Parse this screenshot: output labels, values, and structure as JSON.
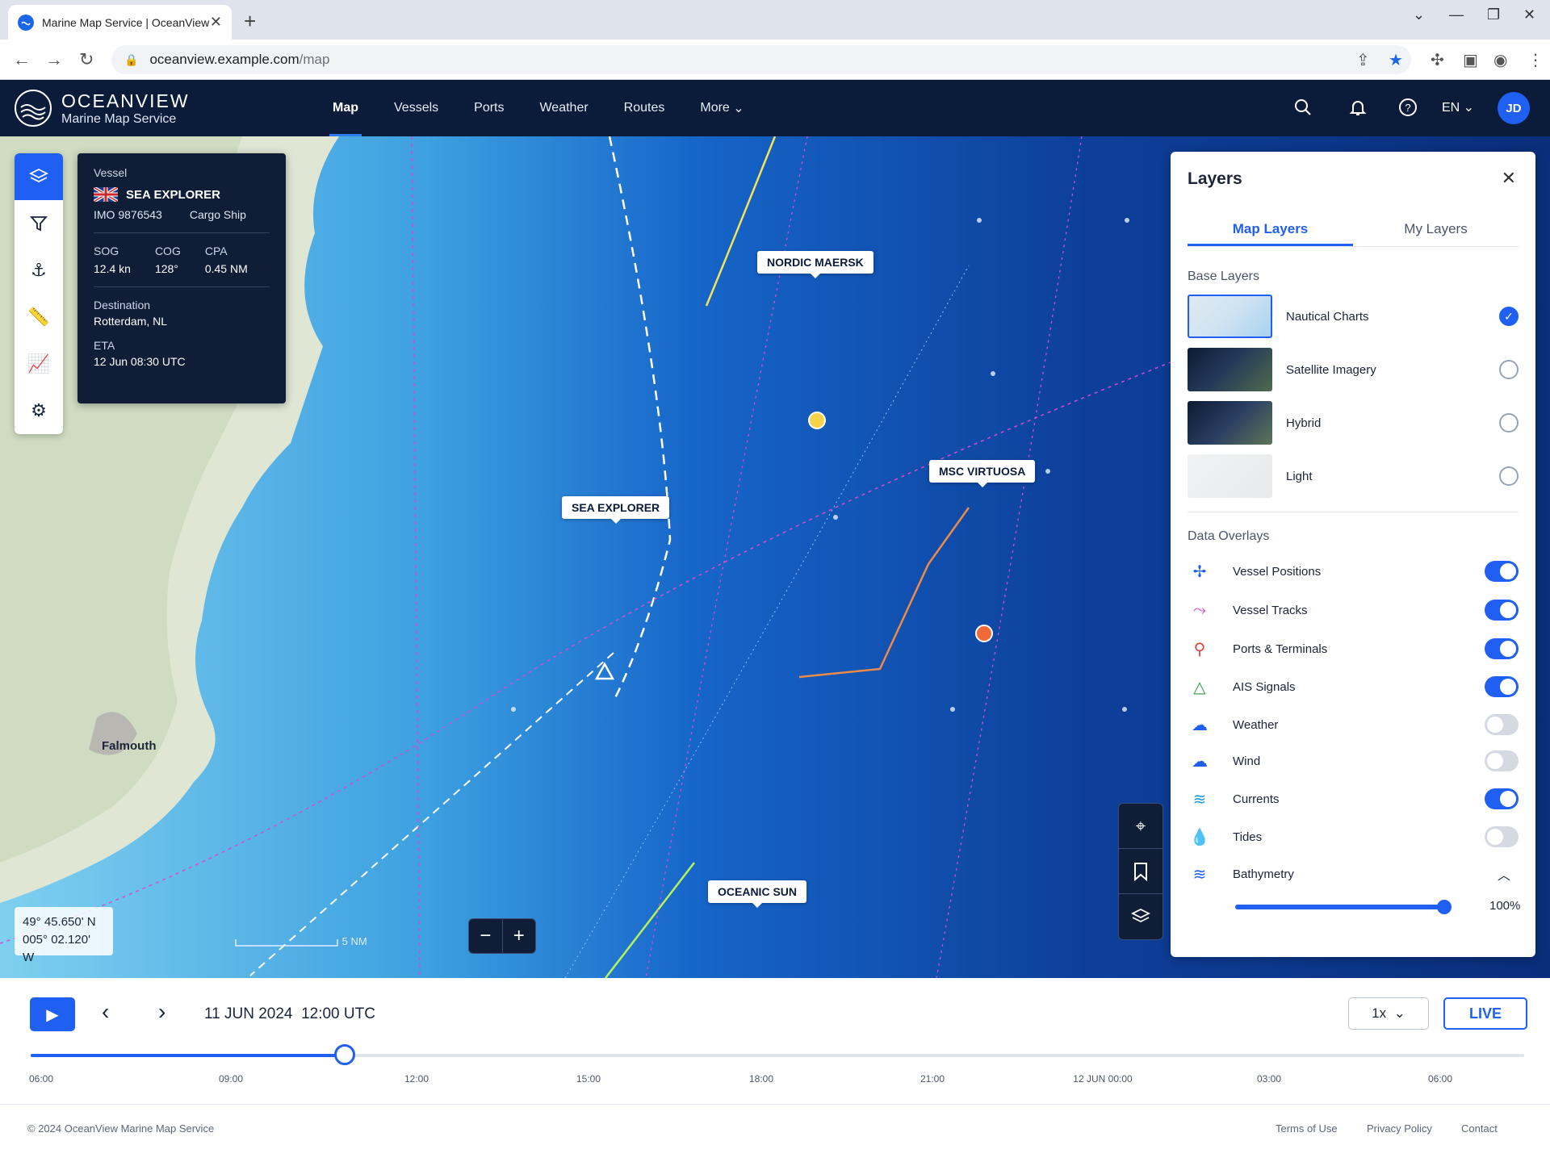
{
  "browser": {
    "tab_title": "Marine Map Service | OceanView",
    "url_host": "oceanview.example.com",
    "url_path": "/map"
  },
  "header": {
    "brand": "OCEANVIEW",
    "brand_sub": "Marine Map Service",
    "nav": [
      "Map",
      "Vessels",
      "Ports",
      "Weather",
      "Routes",
      "More"
    ],
    "active_nav": "Map",
    "language": "EN",
    "avatar_initials": "JD"
  },
  "vessel_card": {
    "label": "Vessel",
    "name": "SEA EXPLORER",
    "imo": "IMO 9876543",
    "type": "Cargo Ship",
    "stats": [
      {
        "k": "SOG",
        "v": "12.4 kn"
      },
      {
        "k": "COG",
        "v": "128°"
      },
      {
        "k": "CPA",
        "v": "0.45 NM"
      }
    ],
    "destination_label": "Destination",
    "destination": "Rotterdam, NL",
    "eta_label": "ETA",
    "eta": "12 Jun 08:30 UTC"
  },
  "map": {
    "vessel_labels": [
      "NORDIC MAERSK",
      "MSC VIRTUOSA",
      "SEA EXPLORER",
      "OCEANIC SUN"
    ],
    "place": "Falmouth",
    "coords_lat": "49° 45.650' N",
    "coords_lon": "005° 02.120' W",
    "scale": "5 NM"
  },
  "layers": {
    "title": "Layers",
    "tabs": [
      "Map Layers",
      "My Layers"
    ],
    "base_title": "Base Layers",
    "base": [
      {
        "name": "Nautical Charts",
        "selected": true
      },
      {
        "name": "Satellite Imagery",
        "selected": false
      },
      {
        "name": "Hybrid",
        "selected": false
      },
      {
        "name": "Light",
        "selected": false
      }
    ],
    "overlay_title": "Data Overlays",
    "overlays": [
      {
        "name": "Vessel Positions",
        "on": true,
        "icon": "vessel-positions-icon",
        "color": "#1f5ff2"
      },
      {
        "name": "Vessel Tracks",
        "on": true,
        "icon": "vessel-tracks-icon",
        "color": "#d64bd1"
      },
      {
        "name": "Ports & Terminals",
        "on": true,
        "icon": "port-icon",
        "color": "#e0463c"
      },
      {
        "name": "AIS Signals",
        "on": true,
        "icon": "ais-icon",
        "color": "#2e9b45"
      },
      {
        "name": "Weather",
        "on": false,
        "icon": "cloud-icon",
        "color": "#1f5ff2"
      },
      {
        "name": "Wind",
        "on": false,
        "icon": "wind-icon",
        "color": "#1f5ff2"
      },
      {
        "name": "Currents",
        "on": true,
        "icon": "currents-icon",
        "color": "#1f9be0"
      },
      {
        "name": "Tides",
        "on": false,
        "icon": "tides-icon",
        "color": "#6b7280"
      },
      {
        "name": "Bathymetry",
        "on": null,
        "icon": "bathymetry-icon",
        "color": "#1f5ff2"
      }
    ],
    "bathymetry_opacity": "100%"
  },
  "timeline": {
    "date": "11 JUN 2024",
    "time": "12:00 UTC",
    "speed": "1x",
    "live": "LIVE",
    "progress": 0.21,
    "ticks": [
      "06:00",
      "09:00",
      "12:00",
      "15:00",
      "18:00",
      "21:00",
      "12 JUN 00:00",
      "03:00",
      "06:00"
    ]
  },
  "footer": {
    "copyright": "© 2024 OceanView Marine Map Service",
    "links": [
      "Terms of Use",
      "Privacy Policy",
      "Contact"
    ]
  }
}
